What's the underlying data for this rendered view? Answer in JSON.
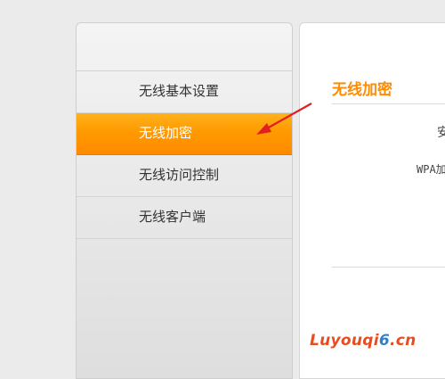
{
  "sidebar": {
    "items": [
      {
        "label": "无线基本设置",
        "active": false
      },
      {
        "label": "无线加密",
        "active": true
      },
      {
        "label": "无线访问控制",
        "active": false
      },
      {
        "label": "无线客户端",
        "active": false
      }
    ]
  },
  "content": {
    "title": "无线加密",
    "clipped_text_1": "安",
    "clipped_text_2": "WPA加"
  },
  "watermark": {
    "part1": "Luyouqi",
    "part2": "6",
    "part3": ".cn"
  },
  "colors": {
    "accent": "#ff9a00",
    "title": "#ff8c00",
    "arrow": "#e02020"
  }
}
